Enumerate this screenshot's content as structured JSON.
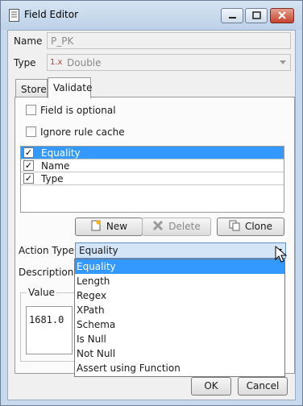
{
  "window": {
    "title": "Field Editor"
  },
  "name_row": {
    "label": "Name",
    "value": "P_PK"
  },
  "type_row": {
    "label": "Type",
    "value": "Double"
  },
  "tabs": [
    {
      "label": "Store"
    },
    {
      "label": "Validate"
    }
  ],
  "options": {
    "field_optional": "Field is optional",
    "ignore_cache": "Ignore rule cache"
  },
  "rules": [
    {
      "label": "Equality",
      "checked": true
    },
    {
      "label": "Name",
      "checked": true
    },
    {
      "label": "Type",
      "checked": true
    }
  ],
  "rule_buttons": {
    "new": "New",
    "delete": "Delete",
    "clone": "Clone"
  },
  "action_type": {
    "label": "Action Type",
    "selected": "Equality",
    "options": [
      "Equality",
      "Length",
      "Regex",
      "XPath",
      "Schema",
      "Is Null",
      "Not Null",
      "Assert using Function"
    ]
  },
  "description_label": "Description",
  "value_group": {
    "label": "Value",
    "text": "1681.0"
  },
  "footer": {
    "ok": "OK",
    "cancel": "Cancel"
  },
  "colors": {
    "selection": "#3399ff",
    "title_bar": "#c7d9ec",
    "close_button": "#c7412b"
  }
}
